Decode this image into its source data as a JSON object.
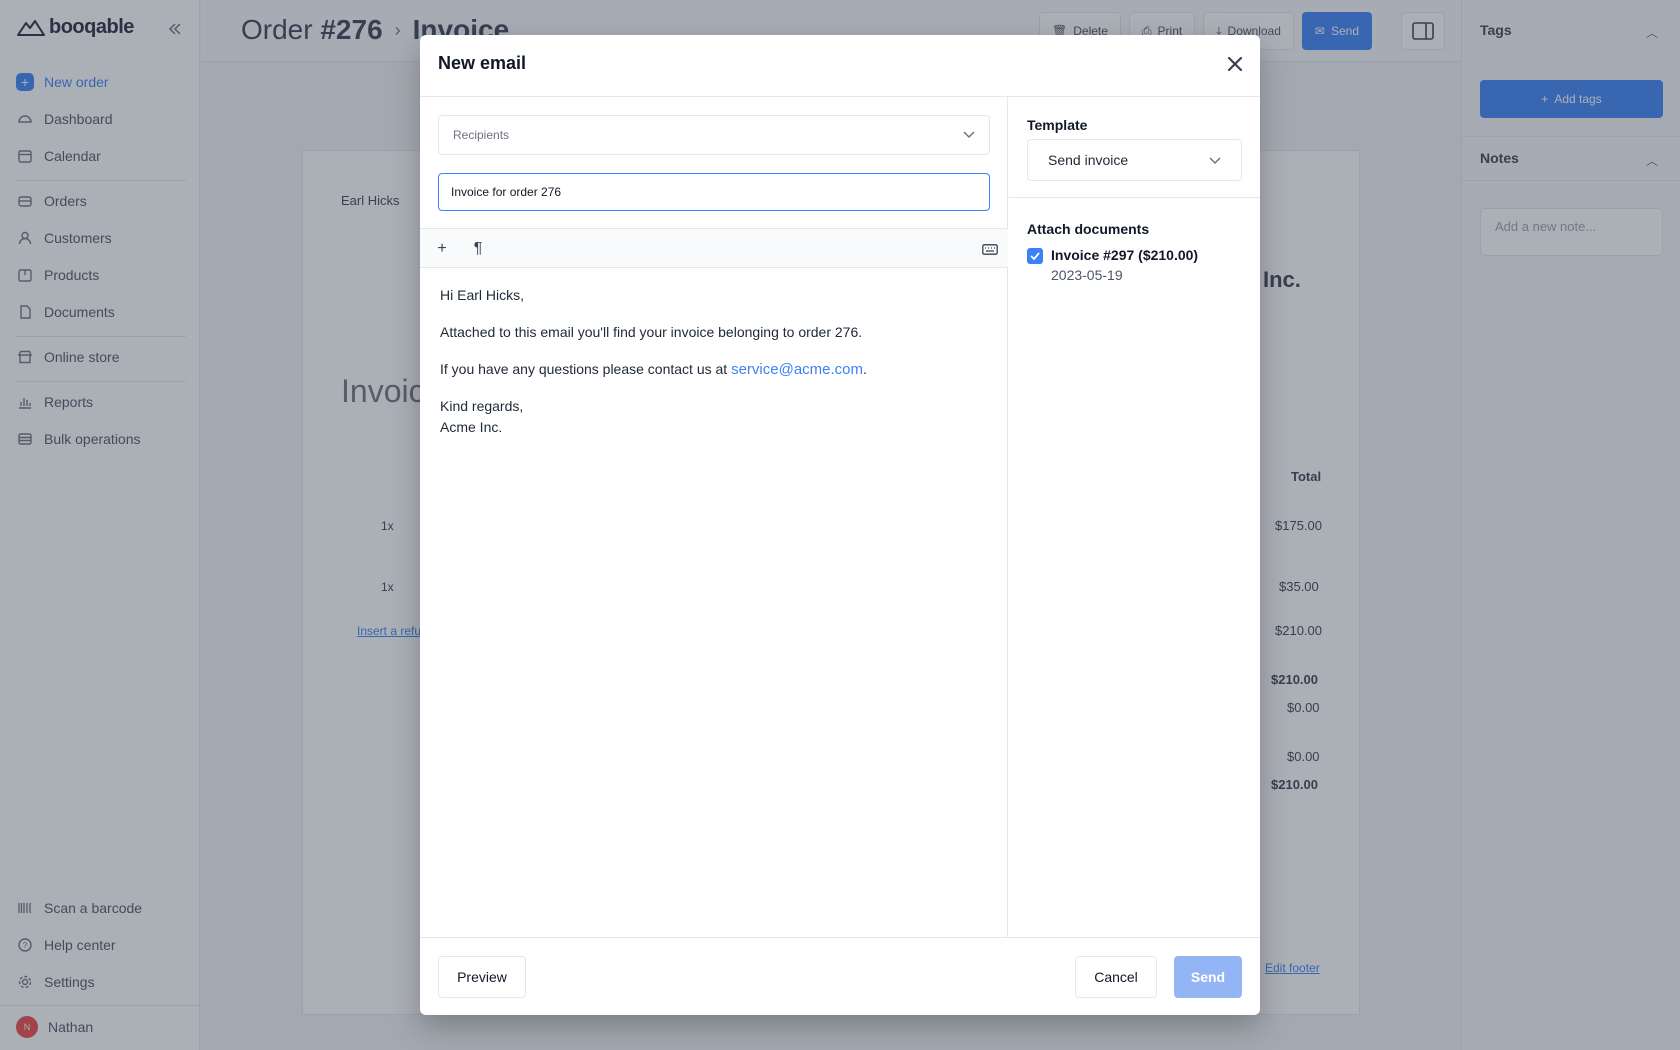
{
  "sidebar": {
    "logo": "booqable",
    "items": [
      {
        "label": "New order"
      },
      {
        "label": "Dashboard"
      },
      {
        "label": "Calendar"
      },
      {
        "label": "Orders"
      },
      {
        "label": "Customers"
      },
      {
        "label": "Products"
      },
      {
        "label": "Documents"
      },
      {
        "label": "Online store"
      },
      {
        "label": "Reports"
      },
      {
        "label": "Bulk operations"
      }
    ],
    "bottom_items": [
      {
        "label": "Scan a barcode"
      },
      {
        "label": "Help center"
      },
      {
        "label": "Settings"
      }
    ],
    "user": {
      "name": "Nathan",
      "initial": "N"
    }
  },
  "header": {
    "breadcrumb": {
      "order_prefix": "Order",
      "order_number": "#276",
      "current": "Invoice"
    },
    "toolbar": {
      "delete": "Delete",
      "print": "Print",
      "download": "Download",
      "send": "Send"
    }
  },
  "document": {
    "customer": "Earl Hicks",
    "title": "Invoice",
    "company_suffix": "Inc.",
    "total_header": "Total",
    "rows": [
      {
        "qty": "1x",
        "total": "$175.00"
      },
      {
        "qty": "1x",
        "total": "$35.00"
      }
    ],
    "insert_link": "Insert a refu",
    "totals": [
      "$210.00",
      "$210.00",
      "$0.00",
      "$0.00",
      "$210.00"
    ],
    "edit_footer": "Edit footer"
  },
  "right_panel": {
    "tags_title": "Tags",
    "add_tags": "Add tags",
    "notes_title": "Notes",
    "note_placeholder": "Add a new note..."
  },
  "modal": {
    "title": "New email",
    "recipients_placeholder": "Recipients",
    "subject": "Invoice for order 276",
    "body": {
      "greeting": "Hi Earl Hicks,",
      "line1": "Attached to this email you'll find your invoice belonging to order 276.",
      "line2_prefix": "If you have any questions please contact us at",
      "email": "service@acme.com",
      "line2_suffix": ".",
      "closing": "Kind regards,",
      "signature": "Acme Inc."
    },
    "template_label": "Template",
    "template_value": "Send invoice",
    "attach_label": "Attach documents",
    "attachment": {
      "name": "Invoice #297 ($210.00)",
      "date": "2023-05-19",
      "checked": true
    },
    "preview": "Preview",
    "cancel": "Cancel",
    "send": "Send"
  },
  "colors": {
    "accent": "#3b82f6",
    "send_disabled": "#93b4f5"
  }
}
